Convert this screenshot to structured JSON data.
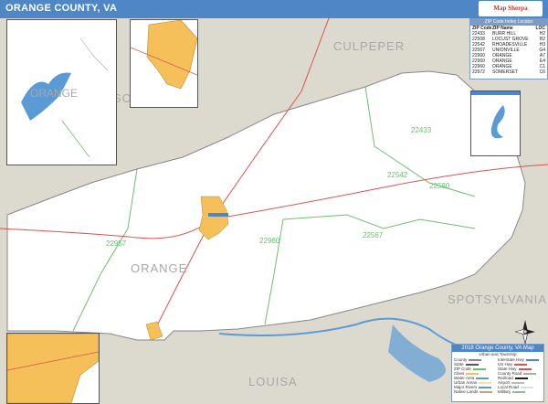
{
  "header": {
    "title": "ORANGE COUNTY, VA",
    "brand": "Map Sherpa",
    "brand_color": "#c0392b"
  },
  "colors": {
    "header": "#4f86c6",
    "land_outside": "#dcd9cf",
    "county": "#ffffff",
    "town": "#f5c05a",
    "water": "#5b9bd5",
    "zip_border": "#6cc16c",
    "road_primary": "#d9534f"
  },
  "map": {
    "county_labels": {
      "culpeper": "CULPEPER",
      "spotsylvania": "SPOTSYLVANIA",
      "louisa": "LOUISA",
      "orange": "ORANGE",
      "orange_inset": "ORANGE",
      "so": "SO"
    },
    "zip_labels": [
      "22433",
      "22542",
      "22580",
      "22567",
      "22960",
      "22957"
    ]
  },
  "zip_table": {
    "title": "ZIP Code Index Locator",
    "headers": {
      "zip": "ZIP Code",
      "name": "ZIP Name",
      "loc": "LOC"
    },
    "rows": [
      {
        "zip": "22433",
        "name": "BURR HILL",
        "loc": "H2"
      },
      {
        "zip": "22508",
        "name": "LOCUST GROVE",
        "loc": "B2"
      },
      {
        "zip": "22542",
        "name": "RHOADESVILLE",
        "loc": "H3"
      },
      {
        "zip": "22567",
        "name": "UNIONVILLE",
        "loc": "G4"
      },
      {
        "zip": "22960",
        "name": "ORANGE",
        "loc": "A7"
      },
      {
        "zip": "22960",
        "name": "ORANGE",
        "loc": "E4"
      },
      {
        "zip": "22960",
        "name": "ORANGE",
        "loc": "C1"
      },
      {
        "zip": "22972",
        "name": "SOMERSET",
        "loc": "C6"
      }
    ]
  },
  "legend": {
    "title": "2018 Orange County, VA Map",
    "subtitle": "Urban and Township",
    "items": [
      {
        "left": "County",
        "right": "Interstate Hwy"
      },
      {
        "left": "State",
        "right": "US Hwy"
      },
      {
        "left": "ZIP Code",
        "right": "State Hwy"
      },
      {
        "left": "Cities",
        "right": "County Road"
      },
      {
        "left": "Water Area",
        "right": "Railroad"
      },
      {
        "left": "Urban Areas",
        "right": "Airport"
      },
      {
        "left": "Major Rivers",
        "right": "Local Road"
      },
      {
        "left": "Native Lands",
        "right": "Military"
      }
    ]
  }
}
